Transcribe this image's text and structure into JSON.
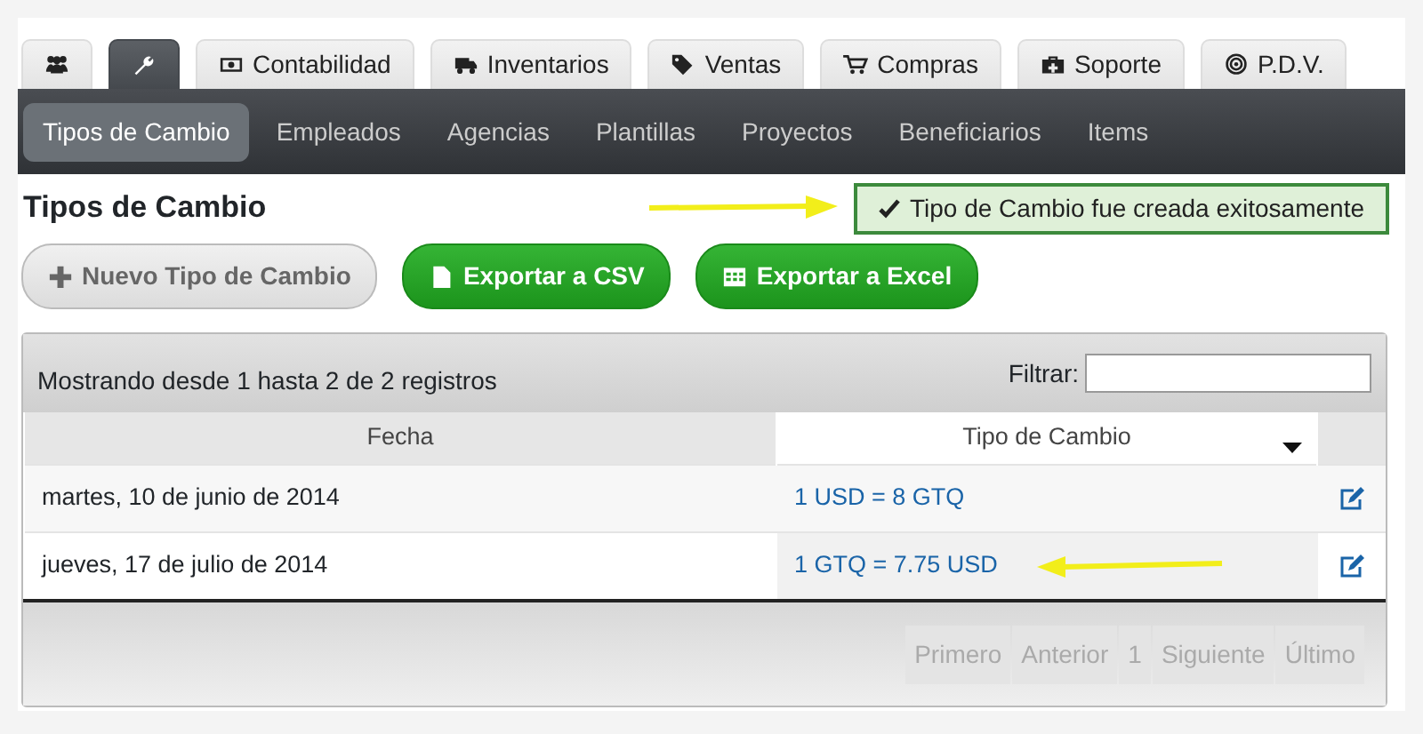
{
  "top_tabs": [
    {
      "kind": "users",
      "selected": false
    },
    {
      "kind": "wrench",
      "selected": true
    },
    {
      "kind": "money",
      "label": "Contabilidad",
      "selected": false
    },
    {
      "kind": "truck",
      "label": "Inventarios",
      "selected": false
    },
    {
      "kind": "tag",
      "label": "Ventas",
      "selected": false
    },
    {
      "kind": "cart",
      "label": "Compras",
      "selected": false
    },
    {
      "kind": "medkit",
      "label": "Soporte",
      "selected": false
    },
    {
      "kind": "target",
      "label": "P.D.V.",
      "selected": false
    }
  ],
  "sub_nav": [
    {
      "label": "Tipos de Cambio",
      "selected": true
    },
    {
      "label": "Empleados",
      "selected": false
    },
    {
      "label": "Agencias",
      "selected": false
    },
    {
      "label": "Plantillas",
      "selected": false
    },
    {
      "label": "Proyectos",
      "selected": false
    },
    {
      "label": "Beneficiarios",
      "selected": false
    },
    {
      "label": "Items",
      "selected": false
    }
  ],
  "page_title": "Tipos de Cambio",
  "alert": "Tipo de Cambio fue creada exitosamente",
  "buttons": [
    {
      "kind": "plus",
      "label": "Nuevo Tipo de Cambio"
    },
    {
      "kind": "file",
      "label": "Exportar a CSV"
    },
    {
      "kind": "table",
      "label": "Exportar a Excel"
    }
  ],
  "table": {
    "info": "Mostrando desde 1 hasta 2 de 2 registros",
    "filter_label": "Filtrar:",
    "columns": [
      {
        "label": "Fecha",
        "sorted": false
      },
      {
        "label": "Tipo de Cambio",
        "sorted": true
      }
    ],
    "rows": [
      {
        "date": "martes, 10 de junio de 2014",
        "rate": "1 USD = 8 GTQ",
        "highlighted": false
      },
      {
        "date": "jueves, 17 de julio de 2014",
        "rate": "1 GTQ = 7.75 USD",
        "highlighted": true
      }
    ],
    "pagination": [
      {
        "label": "Primero",
        "disabled": true
      },
      {
        "label": "Anterior",
        "disabled": true
      },
      {
        "label": "1",
        "disabled": true
      },
      {
        "label": "Siguiente",
        "disabled": true
      },
      {
        "label": "Último",
        "disabled": true
      }
    ]
  }
}
